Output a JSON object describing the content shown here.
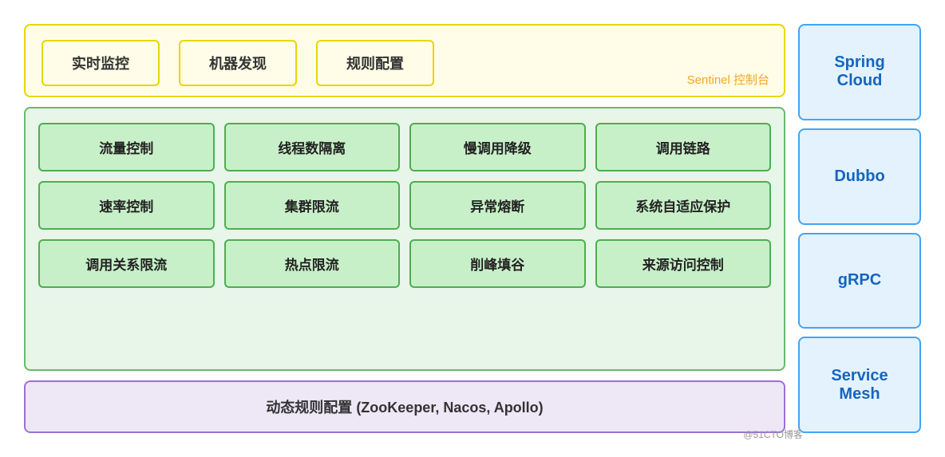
{
  "sentinel": {
    "bg_label": "Sentinel 控制台",
    "boxes": [
      {
        "label": "实时监控"
      },
      {
        "label": "机器发现"
      },
      {
        "label": "规则配置"
      }
    ]
  },
  "features": {
    "rows": [
      [
        {
          "label": "流量控制"
        },
        {
          "label": "线程数隔离"
        },
        {
          "label": "慢调用降级"
        },
        {
          "label": "调用链路"
        }
      ],
      [
        {
          "label": "速率控制"
        },
        {
          "label": "集群限流"
        },
        {
          "label": "异常熔断"
        },
        {
          "label": "系统自适应保护"
        }
      ],
      [
        {
          "label": "调用关系限流"
        },
        {
          "label": "热点限流"
        },
        {
          "label": "削峰填谷"
        },
        {
          "label": "来源访问控制"
        }
      ]
    ]
  },
  "dynamic": {
    "label": "动态规则配置 (ZooKeeper, Nacos, Apollo)"
  },
  "sidebar": {
    "items": [
      {
        "label": "Spring\nCloud"
      },
      {
        "label": "Dubbo"
      },
      {
        "label": "gRPC"
      },
      {
        "label": "Service\nMesh"
      }
    ]
  },
  "watermark": "@51CTO博客"
}
